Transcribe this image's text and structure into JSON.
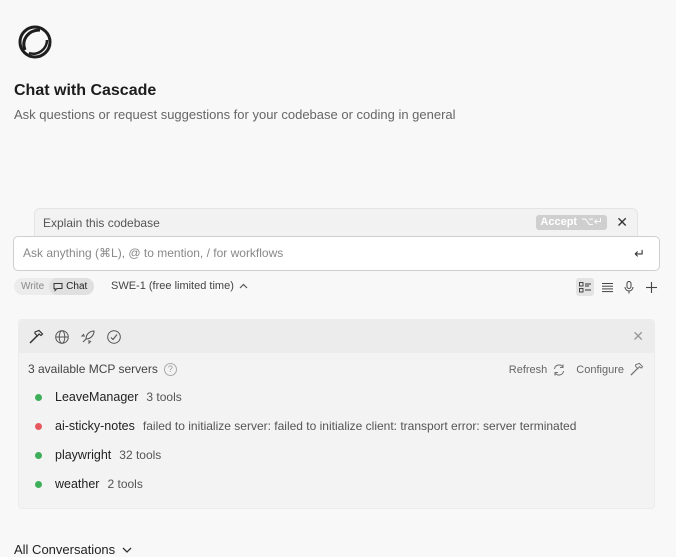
{
  "header": {
    "title": "Chat with Cascade",
    "subtitle": "Ask questions or request suggestions for your codebase or coding in general"
  },
  "suggestion": {
    "text": "Explain this codebase",
    "accept_label": "Accept",
    "accept_shortcut": "⌥↵",
    "close_glyph": "✕"
  },
  "input": {
    "placeholder": "Ask anything (⌘L), @ to mention, / for workflows",
    "value": "",
    "send_glyph": "↵"
  },
  "toolbar": {
    "mode_write": "Write",
    "mode_chat": "Chat",
    "active_mode": "Chat",
    "model": "SWE-1 (free limited time)",
    "icons": [
      "checklist-icon",
      "list-icon",
      "microphone-icon",
      "plus-icon"
    ]
  },
  "mcp": {
    "header_icons": [
      "hammer-icon",
      "globe-icon",
      "rocket-icon",
      "refresh-cycle-icon"
    ],
    "close_glyph": "✕",
    "count_label": "3 available MCP servers",
    "help_glyph": "?",
    "refresh_label": "Refresh",
    "configure_label": "Configure",
    "servers": [
      {
        "name": "LeaveManager",
        "info": "3 tools",
        "status": "ok",
        "color": "#3fae5a"
      },
      {
        "name": "ai-sticky-notes",
        "info": "failed to initialize server: failed to initialize client: transport error: server terminated",
        "status": "error",
        "color": "#e5595e"
      },
      {
        "name": "playwright",
        "info": "32 tools",
        "status": "ok",
        "color": "#3fae5a"
      },
      {
        "name": "weather",
        "info": "2 tools",
        "status": "ok",
        "color": "#3fae5a"
      }
    ]
  },
  "footer": {
    "all_conversations": "All Conversations"
  }
}
